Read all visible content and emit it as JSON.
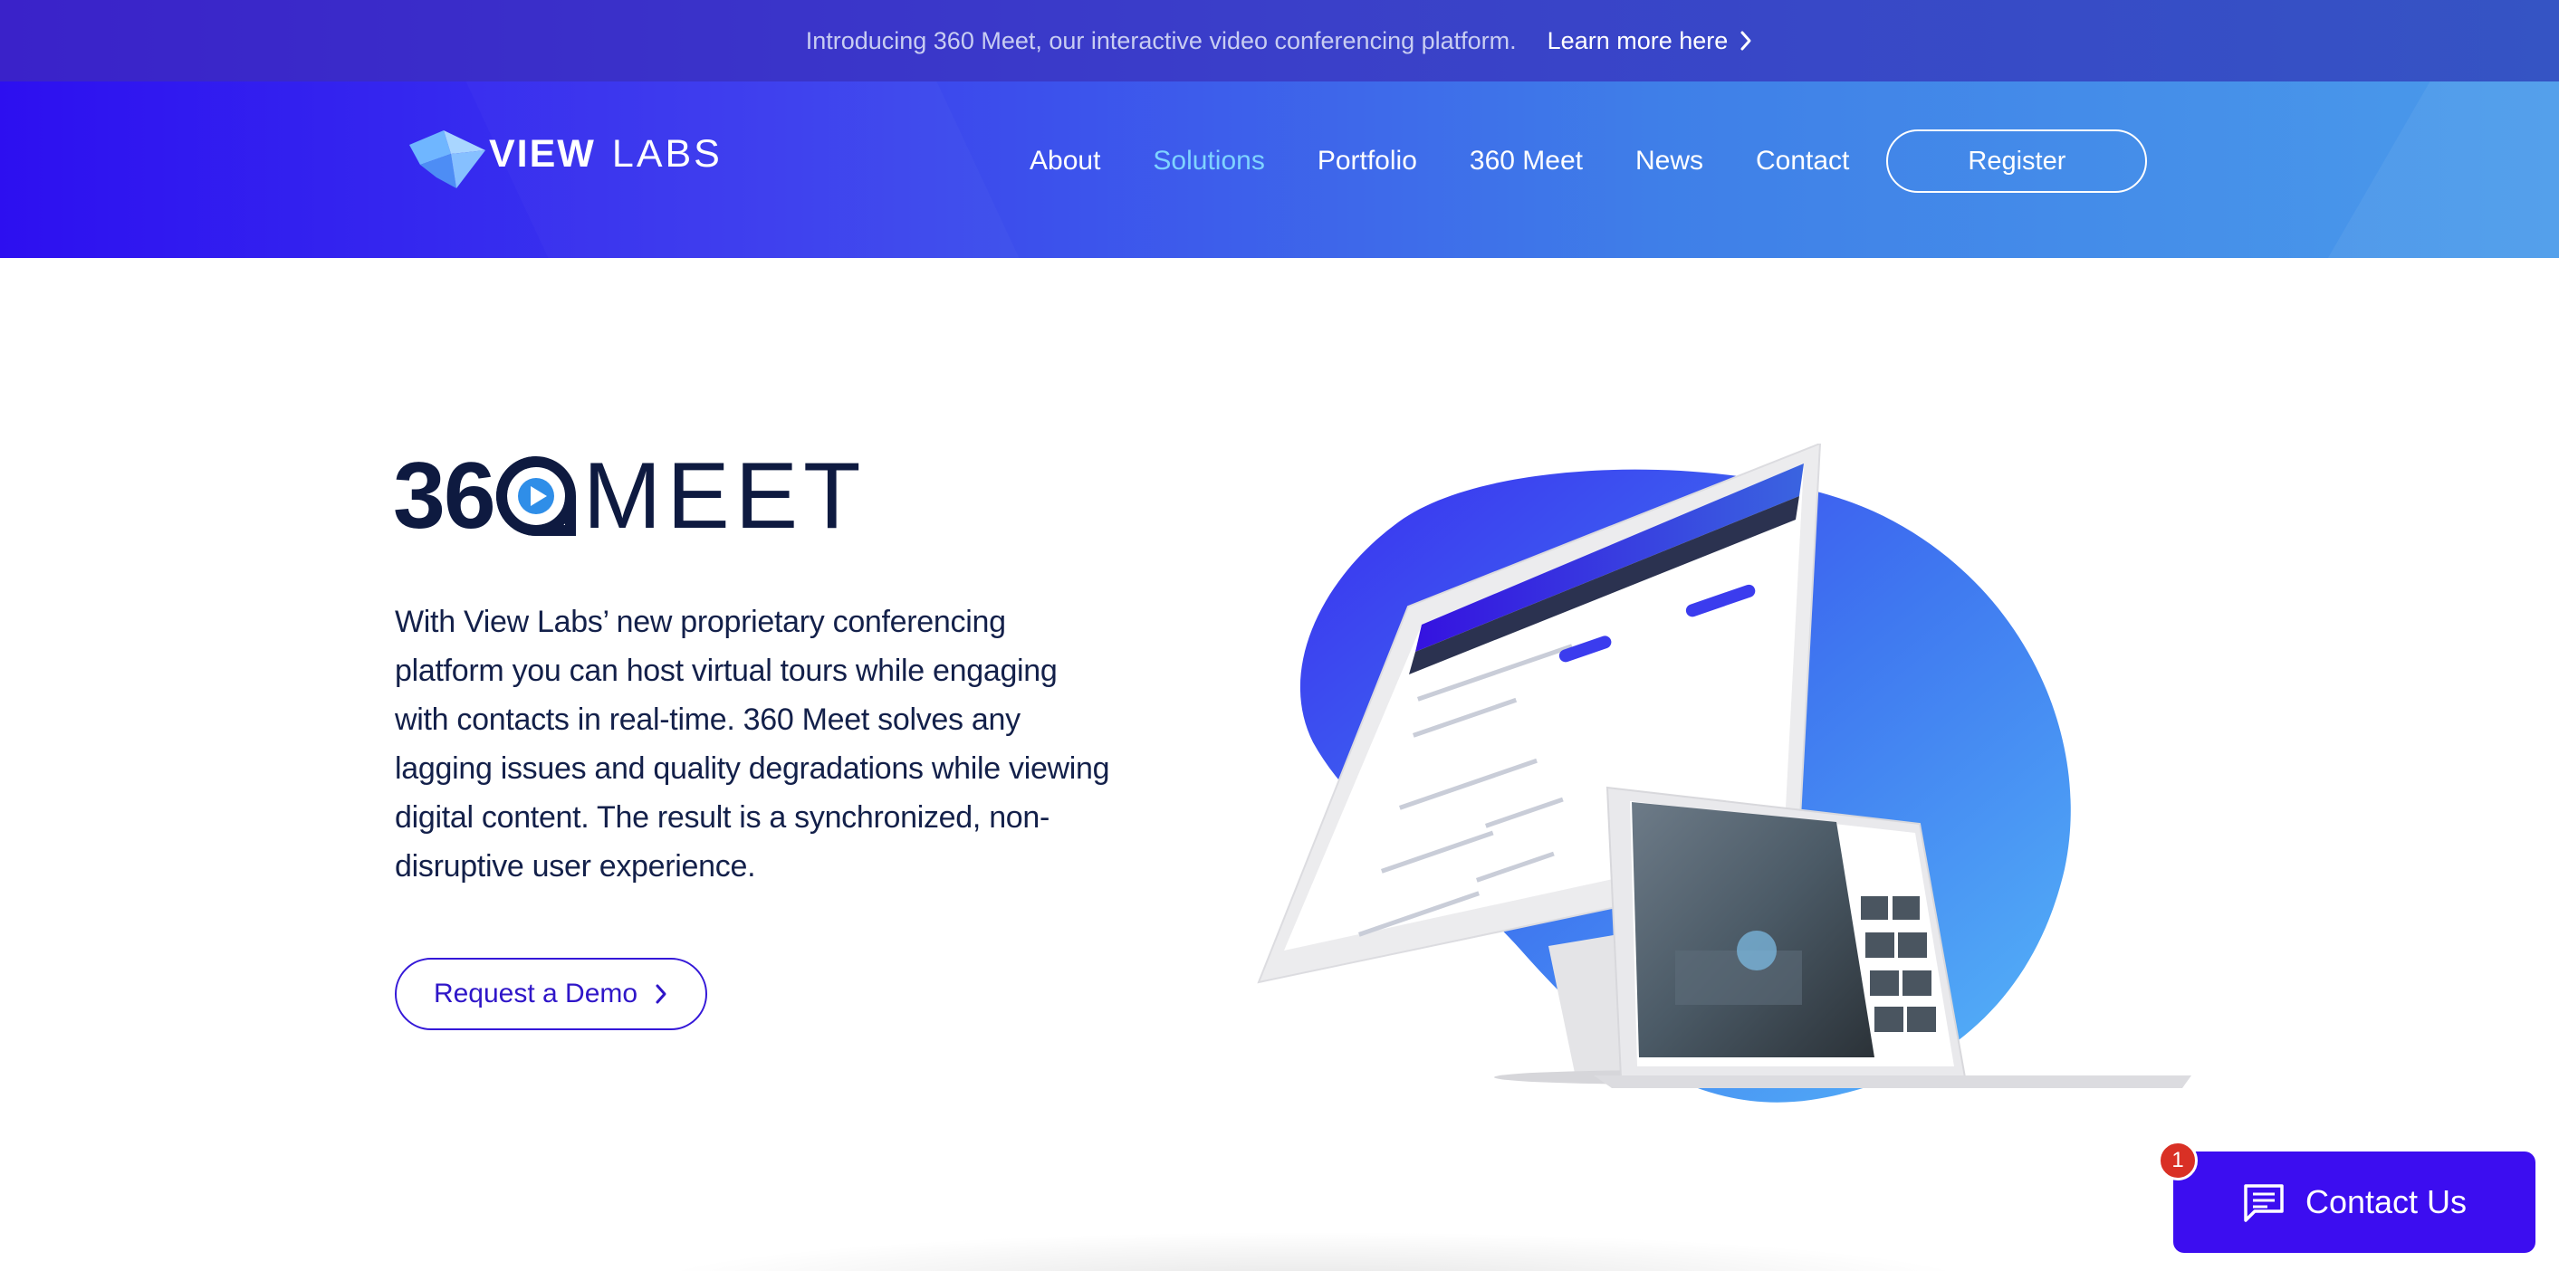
{
  "announcement": {
    "text": "Introducing 360 Meet, our interactive video conferencing platform.",
    "link_label": "Learn more here"
  },
  "brand": {
    "name_bold": "VIEW",
    "name_light": "LABS"
  },
  "nav": {
    "items": [
      "About",
      "Solutions",
      "Portfolio",
      "360 Meet",
      "News",
      "Contact"
    ],
    "active": "Solutions",
    "register_label": "Register"
  },
  "hero": {
    "logo_number": "36",
    "logo_word": "MEET",
    "description": "With View Labs’ new proprietary conferencing platform you can host virtual tours while engaging with contacts in real-time.  360 Meet solves any lagging issues and quality degradations while viewing digital content.  The result is a synchronized, non-disruptive user experience.",
    "cta_label": "Request a Demo"
  },
  "chat_widget": {
    "label": "Contact Us",
    "badge_count": "1"
  },
  "colors": {
    "brand_purple": "#3c0df0",
    "header_blue": "#3f7fe8",
    "active_nav": "#7fd3ff",
    "text_dark": "#0e1a40"
  }
}
